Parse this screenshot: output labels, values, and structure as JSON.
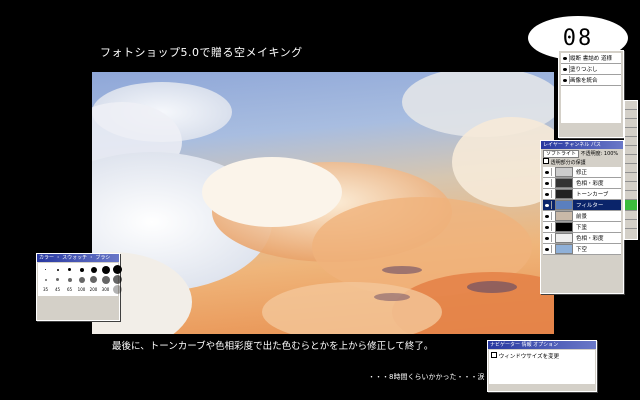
{
  "slide": {
    "title": "フォトショップ5.0で贈る空メイキング",
    "number": "08",
    "caption": "最後に、トーンカーブや色相彩度で出た色むらとかを上から修正して終了。",
    "footnote": "・・・8時間くらいかかった・・・涙"
  },
  "history_panel": {
    "items": [
      {
        "label": "縦断 書詰め 道様"
      },
      {
        "label": "塗りつぶし"
      },
      {
        "label": "画像を統合"
      }
    ]
  },
  "layers_panel": {
    "title": "レイヤー チャンネル パス",
    "mode": "ソフトライト",
    "opacity_label": "不透明度:",
    "opacity": "100%",
    "preserve_label": "透明部分の保護",
    "layers": [
      {
        "label": "修正",
        "selected": false
      },
      {
        "label": "色相・彩度",
        "selected": false
      },
      {
        "label": "トーンカーブ",
        "selected": false
      },
      {
        "label": "フィルター",
        "selected": true
      },
      {
        "label": "前景",
        "selected": false
      },
      {
        "label": "下塗",
        "selected": false
      },
      {
        "label": "色相・彩度",
        "selected": false
      },
      {
        "label": "下空",
        "selected": false
      }
    ]
  },
  "brush_panel": {
    "title": "カラー ・ スウォッチ ・ ブラシ",
    "sizes": [
      "35",
      "45",
      "65",
      "100",
      "200",
      "300",
      "",
      "",
      "",
      "",
      "",
      "",
      "",
      "",
      "",
      ""
    ]
  },
  "navigator_panel": {
    "title": "ナビゲーター 情報 オプション",
    "text": "ウィンドウサイズを変更"
  }
}
